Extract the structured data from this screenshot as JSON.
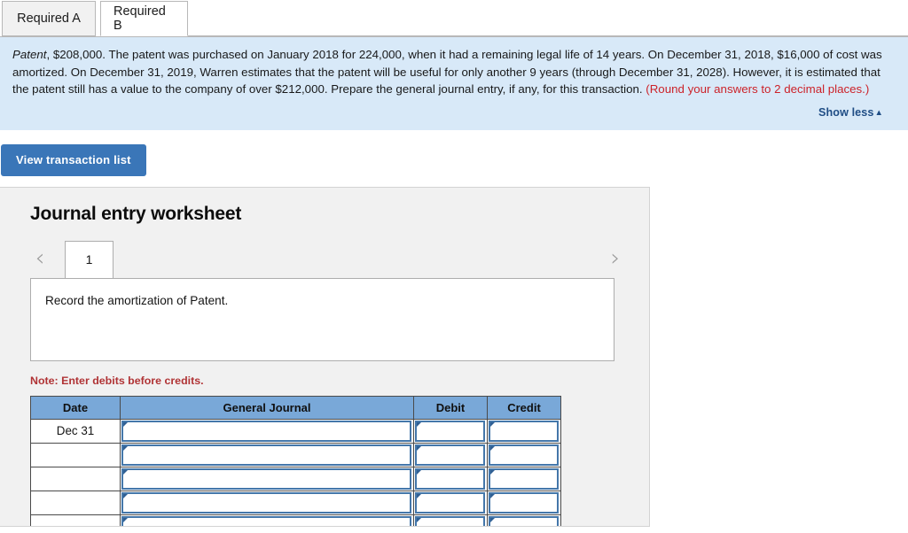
{
  "tabs": [
    {
      "id": "required-a",
      "label": "Required A",
      "active": false
    },
    {
      "id": "required-b",
      "label": "Required B",
      "active": true
    }
  ],
  "banner": {
    "term": "Patent",
    "body_1": ", $208,000. The patent was purchased on January 2018 for 224,000, when it had a remaining legal life of 14 years. On December 31, 2018, $16,000 of cost was amortized. On December 31, 2019, Warren estimates that the patent will be useful for only another 9 years (through December 31, 2028). However, it is estimated that the patent still has a value to the company of over $212,000. Prepare the general journal entry, if any, for this transaction. ",
    "rounding_note": "(Round your answers to 2 decimal places.)",
    "show_less_label": "Show less",
    "show_less_caret": "▲",
    "background_color": "#d8e9f8",
    "rounding_color": "#cc2229",
    "link_color": "#1f4d85"
  },
  "toolbar": {
    "view_transaction_list_label": "View transaction list",
    "primary_color": "#3a76b8"
  },
  "worksheet": {
    "title": "Journal entry worksheet",
    "prev_icon": "‹",
    "next_icon": "›",
    "sheet_tabs": [
      {
        "label": "1",
        "active": true
      }
    ],
    "description": "Record the amortization of Patent.",
    "note": "Note: Enter debits before credits.",
    "note_color": "#b03335",
    "table": {
      "header_color": "#79a8d8",
      "columns": [
        "Date",
        "General Journal",
        "Debit",
        "Credit"
      ],
      "rows": [
        {
          "date": "Dec 31",
          "general_journal": "",
          "debit": "",
          "credit": ""
        },
        {
          "date": "",
          "general_journal": "",
          "debit": "",
          "credit": ""
        },
        {
          "date": "",
          "general_journal": "",
          "debit": "",
          "credit": ""
        },
        {
          "date": "",
          "general_journal": "",
          "debit": "",
          "credit": ""
        },
        {
          "date": "",
          "general_journal": "",
          "debit": "",
          "credit": ""
        }
      ]
    }
  }
}
